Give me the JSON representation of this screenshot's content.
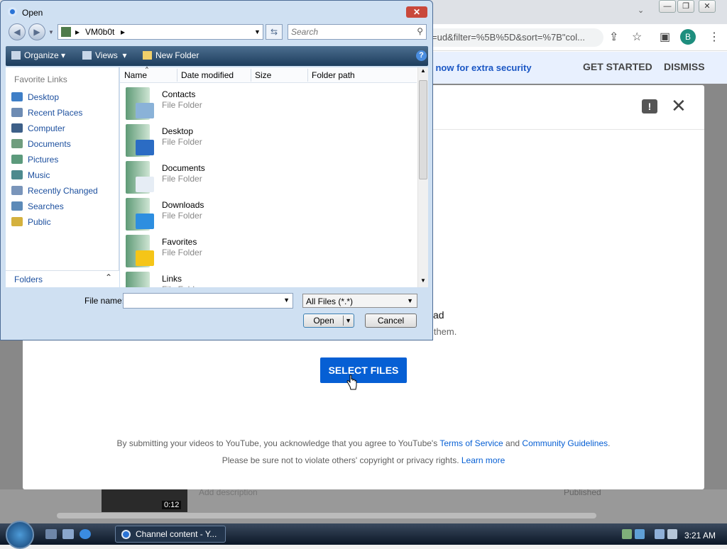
{
  "browser": {
    "url_fragment": "=ud&filter=%5B%5D&sort=%7B\"col...",
    "profile_initial": "B",
    "minimize": "—",
    "restore": "❐",
    "close": "✕",
    "infobar_message": "on now for extra security",
    "get_started": "GET STARTED",
    "dismiss": "DISMISS"
  },
  "upload_modal": {
    "drag_title": "ad",
    "drag_subtitle": "h them.",
    "select_files": "SELECT FILES",
    "legal_prefix": "By submitting your videos to YouTube, you acknowledge that you agree to YouTube's",
    "terms_link": "Terms of Service",
    "and": "and",
    "guidelines_link": "Community Guidelines",
    "period": ".",
    "legal2_prefix": "Please be sure not to violate others' copyright or privacy rights.",
    "learn_more": "Learn more"
  },
  "behind": {
    "thumb_time": "0:12",
    "add_description": "Add description",
    "status": "Published"
  },
  "dialog": {
    "title": "Open",
    "path_segment": "VM0b0t",
    "search_placeholder": "Search",
    "commands": {
      "organize": "Organize",
      "views": "Views",
      "new_folder": "New Folder"
    },
    "favorites_title": "Favorite Links",
    "nav_items": [
      {
        "label": "Desktop",
        "color": "#3f7fc7"
      },
      {
        "label": "Recent Places",
        "color": "#6d8bb3"
      },
      {
        "label": "Computer",
        "color": "#3d5f88"
      },
      {
        "label": "Documents",
        "color": "#6f9d7e"
      },
      {
        "label": "Pictures",
        "color": "#5c9a7c"
      },
      {
        "label": "Music",
        "color": "#4d8a8e"
      },
      {
        "label": "Recently Changed",
        "color": "#7a95ba"
      },
      {
        "label": "Searches",
        "color": "#5c8ab8"
      },
      {
        "label": "Public",
        "color": "#d4b13e"
      }
    ],
    "folders_label": "Folders",
    "columns": [
      "Name",
      "Date modified",
      "Size",
      "Folder path"
    ],
    "files": [
      {
        "name": "Contacts",
        "type": "File Folder",
        "emblem": "#8ab2d8"
      },
      {
        "name": "Desktop",
        "type": "File Folder",
        "emblem": "#2b6cc4"
      },
      {
        "name": "Documents",
        "type": "File Folder",
        "emblem": "#e6edf5"
      },
      {
        "name": "Downloads",
        "type": "File Folder",
        "emblem": "#2d8ee0"
      },
      {
        "name": "Favorites",
        "type": "File Folder",
        "emblem": "#f5c518"
      },
      {
        "name": "Links",
        "type": "File Folder",
        "emblem": "#cfe5d4"
      }
    ],
    "file_name_label": "File name:",
    "file_name_value": "",
    "file_type": "All Files (*.*)",
    "open_button": "Open",
    "cancel_button": "Cancel"
  },
  "taskbar": {
    "task_label": "Channel content - Y...",
    "clock": "3:21 AM"
  }
}
